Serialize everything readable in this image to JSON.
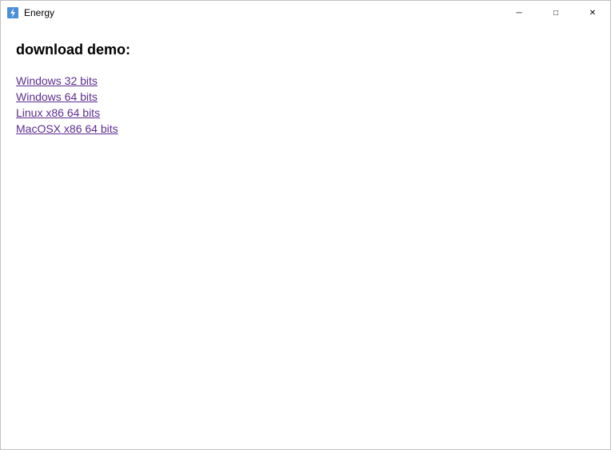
{
  "titlebar": {
    "title": "Energy",
    "icon": "app-icon",
    "controls": {
      "minimize_label": "─",
      "maximize_label": "□",
      "close_label": "✕"
    }
  },
  "content": {
    "heading": "download demo:",
    "links": [
      {
        "label": "Windows 32 bits",
        "href": "#"
      },
      {
        "label": "Windows 64 bits",
        "href": "#"
      },
      {
        "label": "Linux x86 64 bits",
        "href": "#"
      },
      {
        "label": "MacOSX x86 64 bits",
        "href": "#"
      }
    ]
  }
}
